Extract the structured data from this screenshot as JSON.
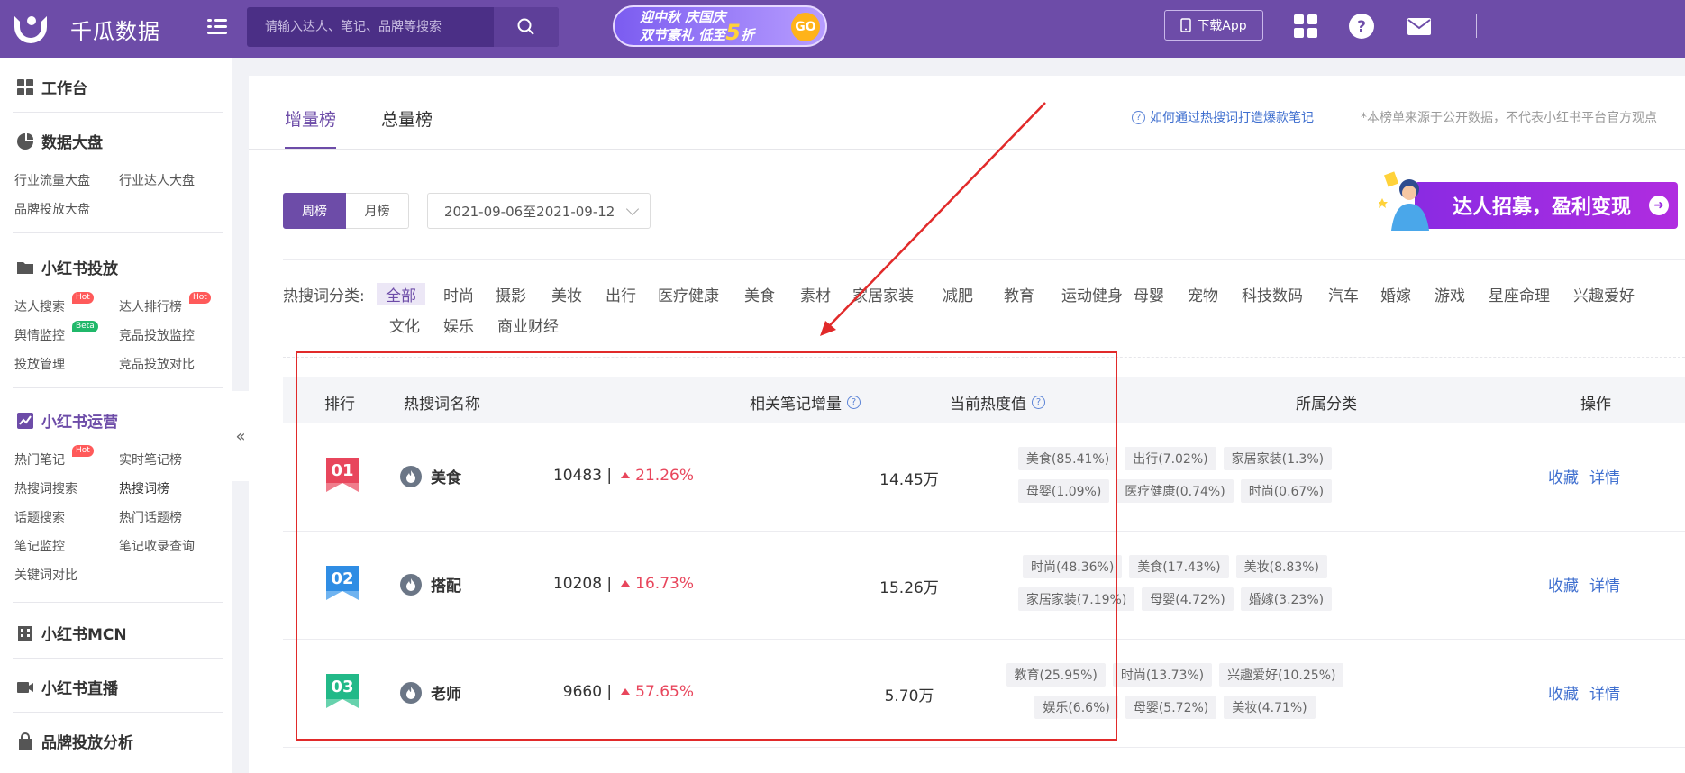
{
  "header": {
    "logo_text": "千瓜数据",
    "search_placeholder": "请输入达人、笔记、品牌等搜索",
    "promo": {
      "line1": "迎中秋 庆国庆",
      "line2_a": "双节豪礼 低至",
      "line2_num": "5",
      "line2_b": "折",
      "go": "GO"
    },
    "download_label": "下载App"
  },
  "sidebar": {
    "workbench": "工作台",
    "data_dashboard": {
      "title": "数据大盘",
      "links": [
        "行业流量大盘",
        "行业达人大盘",
        "品牌投放大盘"
      ]
    },
    "xhs_ads": {
      "title": "小红书投放",
      "links": [
        "达人搜索",
        "达人排行榜",
        "舆情监控",
        "竞品投放监控",
        "投放管理",
        "竞品投放对比"
      ],
      "tag_hot": "Hot",
      "tag_beta": "Beta"
    },
    "xhs_ops": {
      "title": "小红书运营",
      "links": [
        "热门笔记",
        "实时笔记榜",
        "热搜词搜索",
        "热搜词榜",
        "话题搜索",
        "热门话题榜",
        "笔记监控",
        "笔记收录查询",
        "关键词对比"
      ]
    },
    "mcn": "小红书MCN",
    "live": "小红书直播",
    "brand": "品牌投放分析",
    "collapse": "«"
  },
  "main": {
    "tabs": [
      "增量榜",
      "总量榜"
    ],
    "help_link": "如何通过热搜词打造爆款笔记",
    "note": "*本榜单来源于公开数据，不代表小红书平台官方观点",
    "period": {
      "week": "周榜",
      "month": "月榜"
    },
    "date_range": "2021-09-06至2021-09-12",
    "recruit_banner": "达人招募，盈利变现",
    "category_label": "热搜词分类:",
    "categories_row1": [
      "全部",
      "时尚",
      "摄影",
      "美妆",
      "出行",
      "医疗健康",
      "美食",
      "素材",
      "家居家装",
      "减肥",
      "教育",
      "运动健身",
      "母婴",
      "宠物",
      "科技数码",
      "汽车",
      "婚嫁",
      "游戏",
      "星座命理",
      "兴趣爱好"
    ],
    "categories_row2": [
      "文化",
      "娱乐",
      "商业财经"
    ],
    "table": {
      "headers": {
        "rank": "排行",
        "keyword": "热搜词名称",
        "increase": "相关笔记增量",
        "heat": "当前热度值",
        "category": "所属分类",
        "ops": "操作"
      },
      "rows": [
        {
          "rank": "01",
          "keyword": "美食",
          "increase": "10483 |",
          "pct": "21.26%",
          "heat": "14.45万",
          "tags1": [
            "美食(85.41%)",
            "出行(7.02%)",
            "家居家装(1.3%)"
          ],
          "tags2": [
            "母婴(1.09%)",
            "医疗健康(0.74%)",
            "时尚(0.67%)"
          ],
          "fav": "收藏",
          "detail": "详情"
        },
        {
          "rank": "02",
          "keyword": "搭配",
          "increase": "10208 |",
          "pct": "16.73%",
          "heat": "15.26万",
          "tags1": [
            "时尚(48.36%)",
            "美食(17.43%)",
            "美妆(8.83%)"
          ],
          "tags2": [
            "家居家装(7.19%)",
            "母婴(4.72%)",
            "婚嫁(3.23%)"
          ],
          "fav": "收藏",
          "detail": "详情"
        },
        {
          "rank": "03",
          "keyword": "老师",
          "increase": "9660 |",
          "pct": "57.65%",
          "heat": "5.70万",
          "tags1": [
            "教育(25.95%)",
            "时尚(13.73%)",
            "兴趣爱好(10.25%)"
          ],
          "tags2": [
            "娱乐(6.6%)",
            "母婴(5.72%)",
            "美妆(4.71%)"
          ],
          "fav": "收藏",
          "detail": "详情"
        }
      ]
    }
  },
  "colors": {
    "brand": "#6d4ca8",
    "up": "#e8465c",
    "link": "#3f6fcf",
    "highlight": "#e12a2a"
  }
}
